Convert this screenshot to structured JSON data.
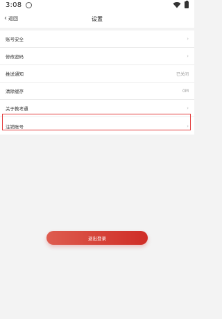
{
  "status_bar": {
    "time": "3:08"
  },
  "nav": {
    "back_label": "返回",
    "title": "设置"
  },
  "settings": [
    {
      "label": "账号安全",
      "value": "",
      "arrow": "›"
    },
    {
      "label": "修改密码",
      "value": "",
      "arrow": "›"
    },
    {
      "label": "推送通知",
      "value": "已关闭",
      "arrow": ""
    },
    {
      "label": "清除缓存",
      "value": "0M",
      "arrow": ""
    },
    {
      "label": "关于教考通",
      "value": "",
      "arrow": "›"
    },
    {
      "label": "注销账号",
      "value": "",
      "arrow": "›"
    }
  ],
  "logout_button": {
    "label": "退出登录"
  },
  "colors": {
    "accent": "#cf2d26",
    "highlight": "#e23b3b"
  }
}
